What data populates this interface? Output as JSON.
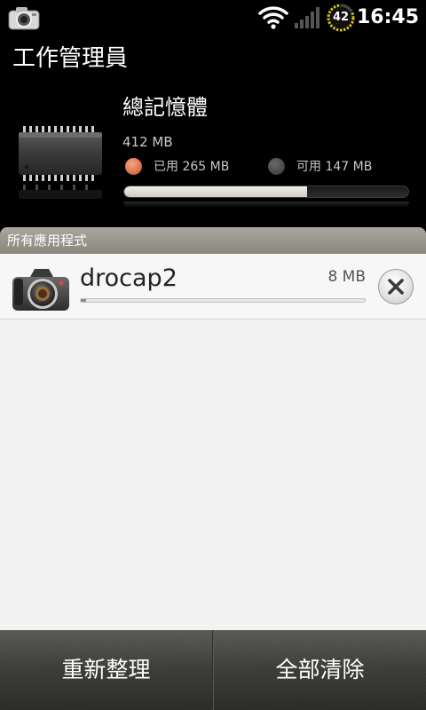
{
  "status_bar": {
    "time": "16:45",
    "battery_level": "42",
    "icons": [
      "camera-icon",
      "wifi-icon",
      "signal-icon",
      "battery-icon"
    ]
  },
  "header": {
    "title": "工作管理員"
  },
  "memory": {
    "title": "總記憶體",
    "total": "412 MB",
    "used_label": "已用 265 MB",
    "free_label": "可用 147 MB",
    "used_fraction": 0.643,
    "used_color": "#d8683f",
    "free_color": "#444444"
  },
  "section": {
    "header": "所有應用程式"
  },
  "apps": [
    {
      "name": "drocap2",
      "size": "8 MB",
      "usage_fraction": 0.02,
      "icon": "camera-icon"
    }
  ],
  "bottom_bar": {
    "refresh_label": "重新整理",
    "clear_all_label": "全部清除"
  }
}
